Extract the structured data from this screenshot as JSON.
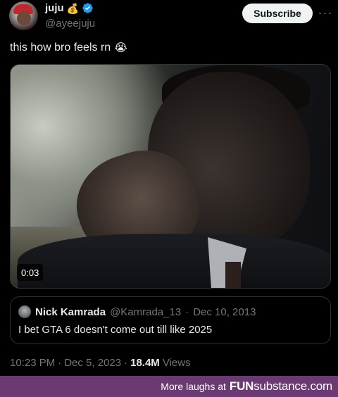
{
  "author": {
    "name": "juju",
    "name_emoji": "💰",
    "handle": "@ayeejuju",
    "verified_color": "#1d9bf0"
  },
  "actions": {
    "subscribe_label": "Subscribe",
    "more_label": "···"
  },
  "tweet": {
    "text": "this how bro feels rn",
    "emoji": "😭"
  },
  "video": {
    "duration": "0:03"
  },
  "quote": {
    "name": "Nick Kamrada",
    "handle": "@Kamrada_13",
    "sep": "·",
    "date": "Dec 10, 2013",
    "text": "I bet GTA 6 doesn't come out till like 2025"
  },
  "meta": {
    "time": "10:23 PM",
    "sep1": "·",
    "date": "Dec 5, 2023",
    "sep2": "·",
    "views_count": "18.4M",
    "views_label": "Views"
  },
  "footer": {
    "prefix": "More laughs at",
    "brand_fun": "FUN",
    "brand_sub": "substance",
    "brand_tld": ".com",
    "color": "#6b3a72"
  }
}
